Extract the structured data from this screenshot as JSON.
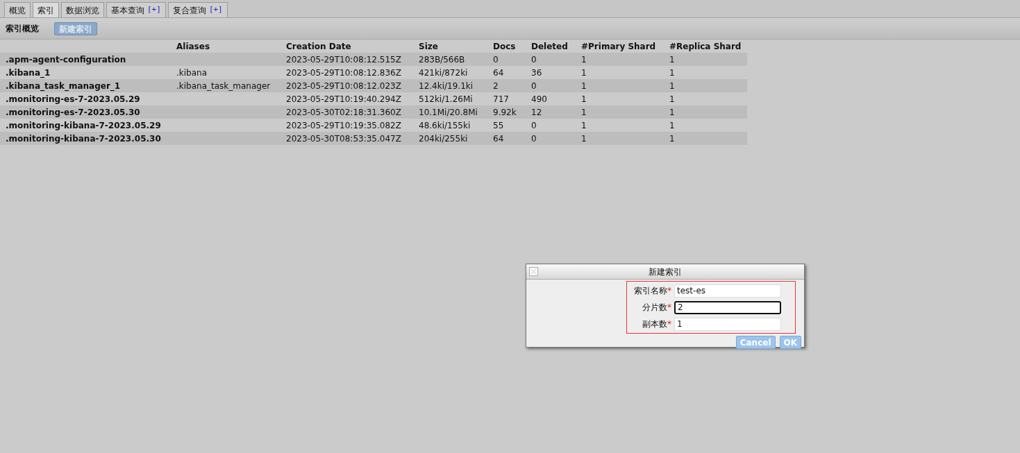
{
  "tabs": [
    {
      "label": "概览",
      "selected": false
    },
    {
      "label": "索引",
      "selected": true
    },
    {
      "label": "数据浏览",
      "selected": false
    },
    {
      "label": "基本查询",
      "plus": "[+]",
      "selected": false
    },
    {
      "label": "复合查询",
      "plus": "[+]",
      "selected": false
    }
  ],
  "toolbar": {
    "title": "索引概览",
    "button": "新建索引"
  },
  "table": {
    "columns": [
      "",
      "Aliases",
      "Creation Date",
      "Size",
      "Docs",
      "Deleted",
      "#Primary Shard",
      "#Replica Shard"
    ],
    "rows": [
      [
        ".apm-agent-configuration",
        "",
        "2023-05-29T10:08:12.515Z",
        "283B/566B",
        "0",
        "0",
        "1",
        "1"
      ],
      [
        ".kibana_1",
        ".kibana",
        "2023-05-29T10:08:12.836Z",
        "421ki/872ki",
        "64",
        "36",
        "1",
        "1"
      ],
      [
        ".kibana_task_manager_1",
        ".kibana_task_manager",
        "2023-05-29T10:08:12.023Z",
        "12.4ki/19.1ki",
        "2",
        "0",
        "1",
        "1"
      ],
      [
        ".monitoring-es-7-2023.05.29",
        "",
        "2023-05-29T10:19:40.294Z",
        "512ki/1.26Mi",
        "717",
        "490",
        "1",
        "1"
      ],
      [
        ".monitoring-es-7-2023.05.30",
        "",
        "2023-05-30T02:18:31.360Z",
        "10.1Mi/20.8Mi",
        "9.92k",
        "12",
        "1",
        "1"
      ],
      [
        ".monitoring-kibana-7-2023.05.29",
        "",
        "2023-05-29T10:19:35.082Z",
        "48.6ki/155ki",
        "55",
        "0",
        "1",
        "1"
      ],
      [
        ".monitoring-kibana-7-2023.05.30",
        "",
        "2023-05-30T08:53:35.047Z",
        "204ki/255ki",
        "64",
        "0",
        "1",
        "1"
      ]
    ]
  },
  "dialog": {
    "title": "新建索引",
    "fields": [
      {
        "label": "索引名称",
        "required_mark": "*",
        "value": "test-es",
        "focused": false
      },
      {
        "label": "分片数",
        "required_mark": "*",
        "value": "2",
        "focused": true
      },
      {
        "label": "副本数",
        "required_mark": "*",
        "value": "1",
        "focused": false
      }
    ],
    "buttons": [
      "Cancel",
      "OK"
    ]
  }
}
